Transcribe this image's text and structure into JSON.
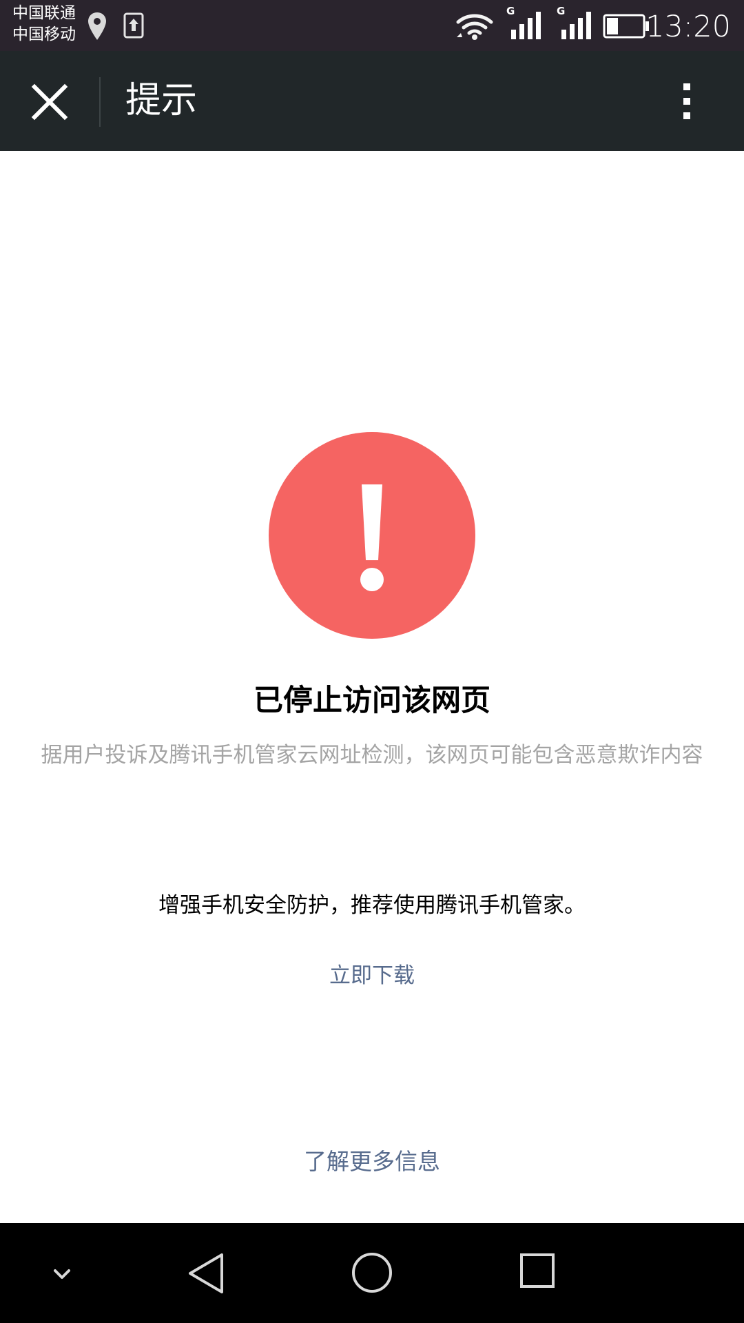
{
  "status_bar": {
    "carrier_1": "中国联通",
    "carrier_2": "中国移动",
    "network_1": "G",
    "network_2": "G",
    "time": "13:20",
    "battery_level": 0.32,
    "icons": [
      "location-icon",
      "upload-icon",
      "wifi-icon",
      "signal-icon",
      "battery-icon"
    ]
  },
  "header": {
    "title": "提示",
    "icons": [
      "close-icon",
      "more-vert-icon"
    ]
  },
  "content": {
    "warning_icon": "exclamation-icon",
    "title": "已停止访问该网页",
    "description": "据用户投诉及腾讯手机管家云网址检测，该网页可能包含恶意欺诈内容",
    "recommendation": "增强手机安全防护，推荐使用腾讯手机管家。",
    "download_label": "立即下载",
    "more_info_label": "了解更多信息"
  },
  "navigation": {
    "icons": [
      "chevron-down-icon",
      "back-icon",
      "home-icon",
      "recents-icon"
    ]
  },
  "colors": {
    "status_bar": "#2a242d",
    "header": "#212729",
    "warning": "#f56462",
    "link": "#576b8d",
    "muted": "#a4a4a4"
  }
}
